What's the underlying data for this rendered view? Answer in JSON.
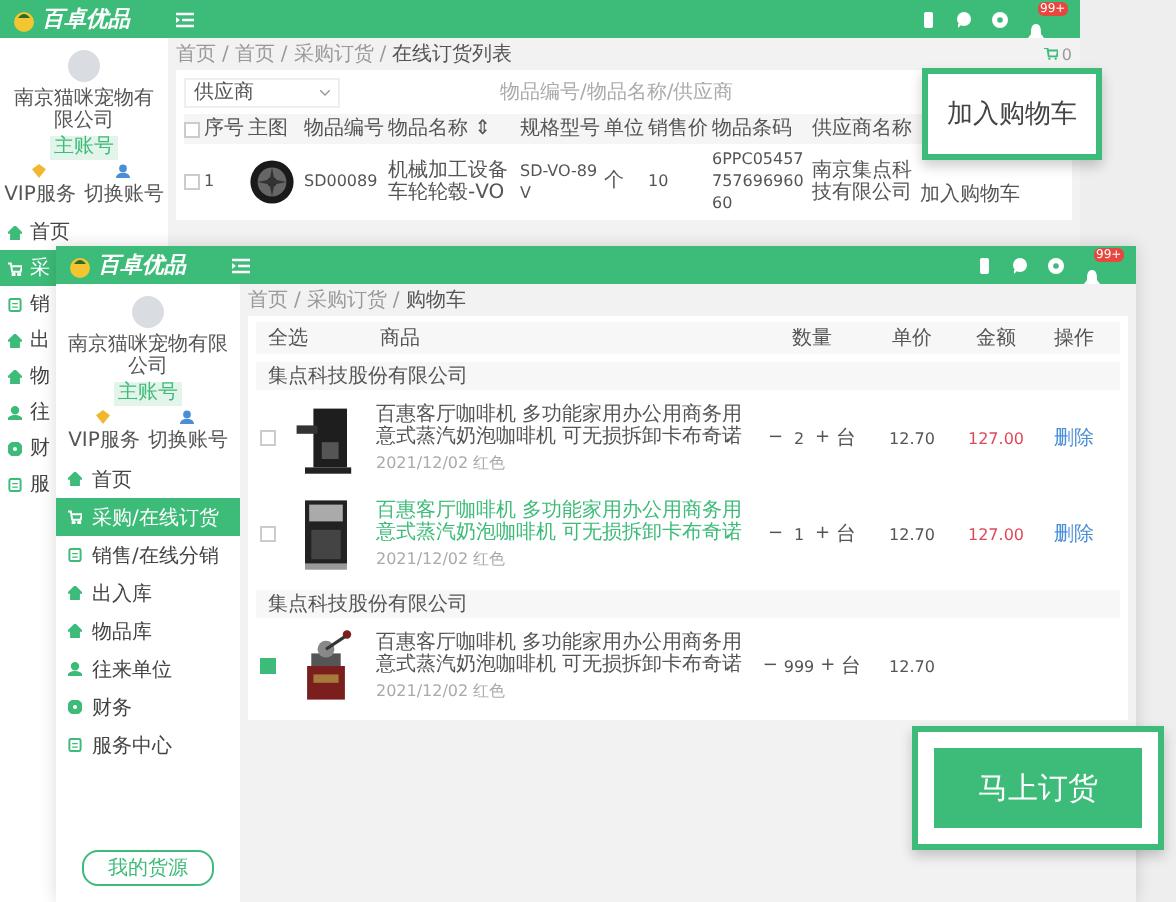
{
  "back_window": {
    "logo": "百卓优品",
    "topbar_badge": "99+",
    "company": "南京猫咪宠物有限公司",
    "account_tag": "主账号",
    "shortcuts": [
      "VIP服务",
      "切换账号"
    ],
    "nav": [
      {
        "label": "首页",
        "selected": false
      },
      {
        "label": "采",
        "selected": true
      },
      {
        "label": "销",
        "selected": false
      },
      {
        "label": "出",
        "selected": false
      },
      {
        "label": "物",
        "selected": false
      },
      {
        "label": "往",
        "selected": false
      },
      {
        "label": "财",
        "selected": false
      },
      {
        "label": "服",
        "selected": false
      }
    ],
    "breadcrumb": [
      {
        "kind": "link",
        "text": "首页"
      },
      {
        "kind": "separator",
        "text": "/"
      },
      {
        "kind": "link",
        "text": "首页"
      },
      {
        "kind": "separator",
        "text": "/"
      },
      {
        "kind": "link",
        "text": "采购订货"
      },
      {
        "kind": "separator",
        "text": "/"
      },
      {
        "kind": "current",
        "text": "在线订货列表"
      }
    ],
    "cart_count": "0",
    "filter": {
      "value": "供应商"
    },
    "search": {
      "placeholder": "物品编号/物品名称/供应商"
    },
    "table": {
      "select_all_checked": false,
      "columns": [
        "序号",
        "主图",
        "物品编号",
        "物品名称 ⇕",
        "规格型号",
        "单位",
        "销售价",
        "物品条码",
        "供应商名称"
      ],
      "rows": [
        {
          "checked": false,
          "cells": [
            "1",
            {
              "kind": "picture"
            },
            "SD00089",
            "机械加工设备车轮轮毂-VO",
            "SD-VO-89V",
            "个",
            "10",
            "6PPC0545775769696060",
            "南京集点科技有限公司"
          ],
          "action": "加入购物车"
        }
      ]
    }
  },
  "callout_add": "加入购物车",
  "front_window": {
    "logo": "百卓优品",
    "topbar_badge": "99+",
    "company": "南京猫咪宠物有限公司",
    "account_tag": "主账号",
    "shortcuts": [
      "VIP服务",
      "切换账号"
    ],
    "nav": [
      {
        "label": "首页",
        "selected": false
      },
      {
        "label": "采购/在线订货",
        "selected": true
      },
      {
        "label": "销售/在线分销",
        "selected": false
      },
      {
        "label": "出入库",
        "selected": false
      },
      {
        "label": "物品库",
        "selected": false
      },
      {
        "label": "往来单位",
        "selected": false
      },
      {
        "label": "财务",
        "selected": false
      },
      {
        "label": "服务中心",
        "selected": false
      }
    ],
    "sidebar_button": "我的货源",
    "breadcrumb": [
      {
        "kind": "link",
        "text": "首页"
      },
      {
        "kind": "separator",
        "text": "/"
      },
      {
        "kind": "link",
        "text": "采购订货"
      },
      {
        "kind": "separator",
        "text": "/"
      },
      {
        "kind": "current",
        "text": "购物车"
      }
    ],
    "columns": [
      "全选",
      "商品",
      "数量",
      "单价",
      "金额",
      "操作"
    ],
    "groups": [
      {
        "supplier": "集点科技股份有限公司",
        "items": [
          {
            "checked": false,
            "highlighted": false,
            "title": "百惠客厅咖啡机 多功能家用办公用商务用意式蒸汽奶泡咖啡机 可无损拆卸卡布奇诺",
            "meta": "2021/12/02 红色",
            "minus": "−",
            "quantity": "2",
            "plus": "+",
            "unit": "台",
            "price": "12.70",
            "amount": "127.00",
            "action": "删除"
          },
          {
            "checked": false,
            "highlighted": true,
            "title": "百惠客厅咖啡机 多功能家用办公用商务用意式蒸汽奶泡咖啡机 可无损拆卸卡布奇诺",
            "meta": "2021/12/02 红色",
            "minus": "−",
            "quantity": "1",
            "plus": "+",
            "unit": "台",
            "price": "12.70",
            "amount": "127.00",
            "action": "删除"
          }
        ]
      },
      {
        "supplier": "集点科技股份有限公司",
        "items": [
          {
            "checked": true,
            "highlighted": false,
            "title": "百惠客厅咖啡机 多功能家用办公用商务用意式蒸汽奶泡咖啡机 可无损拆卸卡布奇诺",
            "meta": "2021/12/02 红色",
            "minus": "−",
            "quantity": "999",
            "plus": "+",
            "unit": "台",
            "price": "12.70"
          }
        ]
      }
    ]
  },
  "callout_order": "马上订货"
}
